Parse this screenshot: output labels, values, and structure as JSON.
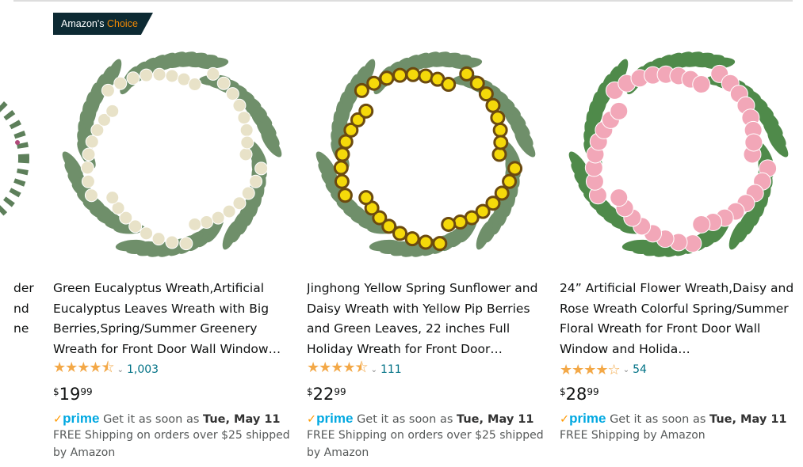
{
  "badge": {
    "prefix": "Amazon's",
    "highlight": "Choice"
  },
  "partial_card": {
    "lines": [
      "der",
      "nd",
      "ne"
    ]
  },
  "products": [
    {
      "title": "Green Eucalyptus Wreath,Artificial Eucalyptus Leaves Wreath with Big Berries,Spring/Summer Greenery Wreath for Front Door Wall Window…",
      "rating": 4.5,
      "stars": "★★★★⯪",
      "reviews": "1,003",
      "currency": "$",
      "price_whole": "19",
      "price_fraction": "99",
      "prime": "prime",
      "delivery_prefix": "Get it as soon as",
      "delivery_date": "Tue, May 11",
      "shipping": "FREE Shipping on orders over $25 shipped by Amazon",
      "colors": [
        "#6f8f6a",
        "#e8e2c8"
      ]
    },
    {
      "title": "Jinghong Yellow Spring Sunflower and Daisy Wreath with Yellow Pip Berries and Green Leaves, 22 inches Full Holiday Wreath for Front Door…",
      "rating": 4.5,
      "stars": "★★★★⯪",
      "reviews": "111",
      "currency": "$",
      "price_whole": "22",
      "price_fraction": "99",
      "prime": "prime",
      "delivery_prefix": "Get it as soon as",
      "delivery_date": "Tue, May 11",
      "shipping": "FREE Shipping on orders over $25 shipped by Amazon",
      "colors": [
        "#6f8f6a",
        "#f5d90a"
      ]
    },
    {
      "title": "24” Artificial Flower Wreath,Daisy and Rose Wreath Colorful Spring/Summer Floral Wreath for Front Door Wall Window and Holida…",
      "rating": 4,
      "stars": "★★★★☆",
      "reviews": "54",
      "currency": "$",
      "price_whole": "28",
      "price_fraction": "99",
      "prime": "prime",
      "delivery_prefix": "Get it as soon as",
      "delivery_date": "Tue, May 11",
      "shipping": "FREE Shipping by Amazon",
      "colors": [
        "#4f8a4a",
        "#f2a7b8"
      ]
    }
  ]
}
